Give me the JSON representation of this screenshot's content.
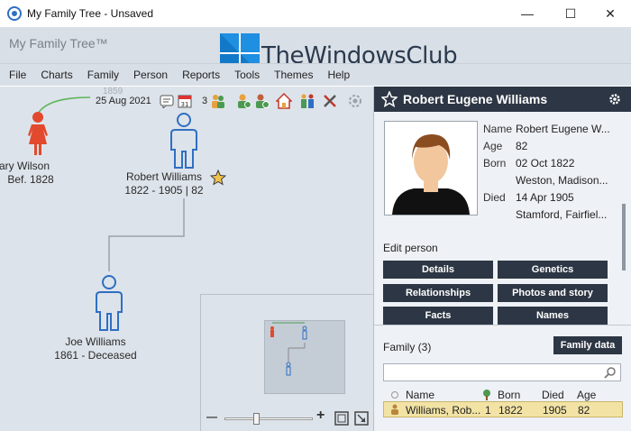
{
  "window": {
    "title": "My Family Tree - Unsaved",
    "controls": {
      "minimize": "—",
      "maximize": "☐",
      "close": "✕"
    }
  },
  "app": {
    "name": "My Family Tree™"
  },
  "watermark": {
    "text": "TheWindowsClub"
  },
  "menu": [
    "File",
    "Charts",
    "Family",
    "Person",
    "Reports",
    "Tools",
    "Themes",
    "Help"
  ],
  "toolbar": {
    "ghost_year": "1859",
    "date": "25 Aug 2021",
    "count": "3"
  },
  "tree": {
    "people": [
      {
        "name": "ary Wilson",
        "dates": "Bef. 1828",
        "gender": "female"
      },
      {
        "name": "Robert Williams",
        "dates": "1822 - 1905 | 82",
        "gender": "male",
        "starred": true
      },
      {
        "name": "Joe Williams",
        "dates": "1861 - Deceased",
        "gender": "male"
      }
    ]
  },
  "minimap": {
    "zoom_minus": "—",
    "zoom_plus": "+",
    "zoom_level": 0.35
  },
  "panel": {
    "person_name": "Robert Eugene Williams",
    "details": [
      {
        "key": "Name",
        "value": "Robert Eugene W..."
      },
      {
        "key": "Age",
        "value": "82"
      },
      {
        "key": "Born",
        "value": "02 Oct 1822"
      },
      {
        "key": "",
        "value": "Weston, Madison..."
      },
      {
        "key": "Died",
        "value": "14 Apr 1905"
      },
      {
        "key": "",
        "value": "Stamford, Fairfiel..."
      }
    ],
    "edit_label": "Edit person",
    "edit_buttons": [
      "Details",
      "Genetics",
      "Relationships",
      "Photos and story",
      "Facts",
      "Names"
    ],
    "family": {
      "title": "Family (3)",
      "data_button": "Family data",
      "columns": [
        "Name",
        "Born",
        "Died",
        "Age"
      ],
      "rows": [
        {
          "name": "Williams, Rob...",
          "marker": "1",
          "born": "1822",
          "died": "1905",
          "age": "82"
        }
      ]
    }
  },
  "colors": {
    "accent_dark": "#2d3644",
    "female": "#e2492d",
    "male": "#2f6fc2",
    "selected_row": "#f2e3a5"
  }
}
